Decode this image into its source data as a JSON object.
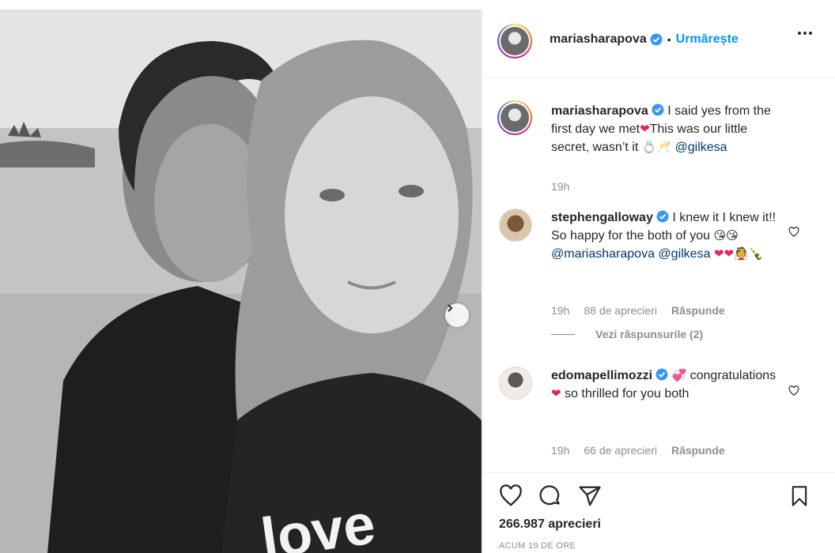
{
  "post": {
    "author": "mariasharapova",
    "follow_label": "Urmărește",
    "caption_author": "mariasharapova",
    "caption_text_1": "I said yes from the first day we met",
    "caption_text_2": "This was our little secret, wasn’t it",
    "caption_mention": "@gilkesa",
    "caption_time": "19h",
    "likes": "266.987 aprecieri",
    "posted_ago": "ACUM 19 DE ORE",
    "photo_text": "love"
  },
  "comments": [
    {
      "author": "stephengalloway",
      "text_1": "I knew it I knew it!! So happy for the both of you",
      "mention_1": "@mariasharapova",
      "mention_2": "@gilkesa",
      "time": "19h",
      "likes": "88 de aprecieri",
      "reply": "Răspunde",
      "view_replies": "Vezi răspunsurile (2)"
    },
    {
      "author": "edomapellimozzi",
      "text_1": "congratulations",
      "text_2": "so thrilled for you both",
      "time": "19h",
      "likes": "66 de aprecieri",
      "reply": "Răspunde"
    }
  ],
  "icons": {
    "verified": "verified-badge-icon",
    "more": "more-options-icon",
    "like": "heart-icon",
    "comment": "comment-icon",
    "share": "share-icon",
    "save": "bookmark-icon",
    "next": "chevron-right-icon"
  },
  "colors": {
    "accent": "#0095f6",
    "verified": "#3897f0",
    "text": "#262626",
    "muted": "#8e8e8e",
    "mention": "#00376b",
    "heart_emoji": "#e0245e"
  }
}
